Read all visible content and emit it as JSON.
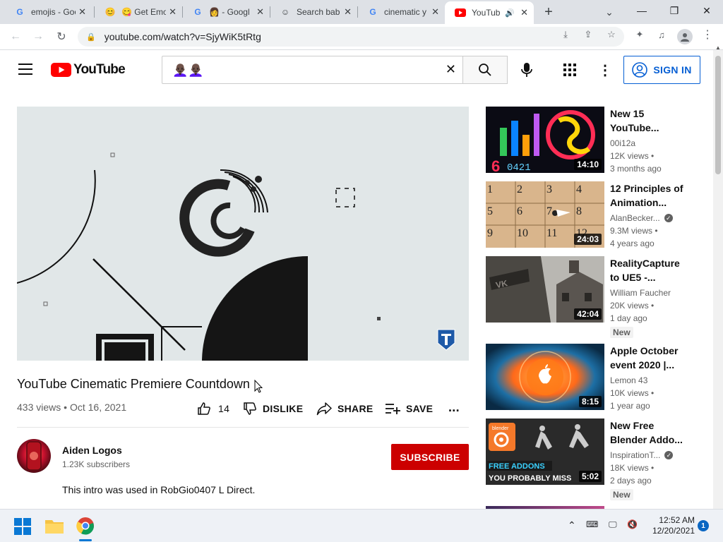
{
  "browser": {
    "tabs": [
      {
        "label": "emojis - Goo",
        "icon": "google-g-icon"
      },
      {
        "label": "Get Emo",
        "icon": "emoji-icon"
      },
      {
        "label": "- Googl",
        "icon": "google-g-icon"
      },
      {
        "label": "Search bab",
        "icon": "smiley-icon"
      },
      {
        "label": "cinematic y",
        "icon": "google-g-icon"
      },
      {
        "label": "YouTub",
        "icon": "youtube-icon"
      }
    ],
    "url": "youtube.com/watch?v=SjyWiK5tRtg"
  },
  "youtube": {
    "logo_text": "YouTube",
    "search_value": "",
    "signin_label": "SIGN IN"
  },
  "video": {
    "title": "YouTube Cinematic Premiere Countdown",
    "views": "433 views",
    "date": "Oct 16, 2021",
    "meta_sep": " • ",
    "likes": "14",
    "dislike_label": "DISLIKE",
    "share_label": "SHARE",
    "save_label": "SAVE",
    "more_label": "...",
    "channel_name": "Aiden Logos",
    "subscribers": "1.23K subscribers",
    "subscribe_label": "SUBSCRIBE",
    "description": "This intro was used in RobGio0407 L Direct."
  },
  "recommendations": [
    {
      "title": "New 15 YouTube...",
      "channel": "00i12a",
      "views": "12K views •",
      "age": "3 months ago",
      "duration": "14:10",
      "verified": false,
      "badge": ""
    },
    {
      "title": "12 Principles of Animation...",
      "channel": "AlanBecker...",
      "views": "9.3M views •",
      "age": "4 years ago",
      "duration": "24:03",
      "verified": true,
      "badge": ""
    },
    {
      "title": "RealityCapture to UE5 -...",
      "channel": "William Faucher",
      "views": "20K views •",
      "age": "1 day ago",
      "duration": "42:04",
      "verified": false,
      "badge": "New"
    },
    {
      "title": "Apple October event 2020 |...",
      "channel": "Lemon 43",
      "views": "10K views •",
      "age": "1 year ago",
      "duration": "8:15",
      "verified": false,
      "badge": ""
    },
    {
      "title": "New Free Blender Addo...",
      "channel": "InspirationT...",
      "views": "18K views •",
      "age": "2 days ago",
      "duration": "5:02",
      "verified": true,
      "badge": "New"
    }
  ],
  "thumb_text": {
    "blender_label": "blender",
    "free_addons": "FREE ADDONS",
    "you_probably": "YOU PROBABLY MISS"
  },
  "taskbar": {
    "time": "12:52 AM",
    "date": "12/20/2021",
    "notifications": "1"
  }
}
